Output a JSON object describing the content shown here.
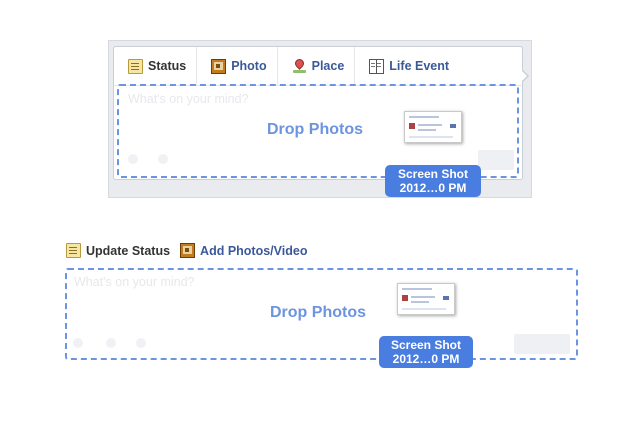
{
  "top_composer": {
    "tabs": [
      {
        "label": "Status",
        "icon": "status-icon"
      },
      {
        "label": "Photo",
        "icon": "photo-icon"
      },
      {
        "label": "Place",
        "icon": "place-icon"
      },
      {
        "label": "Life Event",
        "icon": "life-event-icon"
      }
    ],
    "placeholder": "What's on your mind?",
    "drop_label": "Drop Photos",
    "file_pill": {
      "line1": "Screen Shot",
      "line2": "2012…0 PM"
    }
  },
  "bottom_composer": {
    "tabs": [
      {
        "label": "Update Status",
        "icon": "status-icon"
      },
      {
        "label": "Add Photos/Video",
        "icon": "photo-icon"
      }
    ],
    "placeholder": "What's on your mind?",
    "drop_label": "Drop Photos",
    "file_pill": {
      "line1": "Screen Shot",
      "line2": "2012…0 PM"
    }
  },
  "colors": {
    "accent": "#6d94e0",
    "pill": "#4a7de0",
    "link": "#3b5998"
  }
}
